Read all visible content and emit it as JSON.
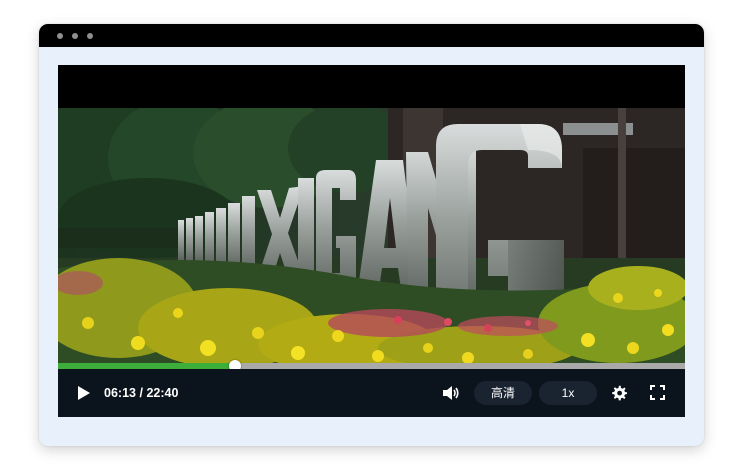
{
  "window": {
    "titlebar_dots": [
      "dot",
      "dot",
      "dot"
    ]
  },
  "player": {
    "video_description_icon": "video-frame",
    "progress": 0.2815,
    "controls": {
      "play_icon": "play-icon",
      "time_current": "06:13",
      "time_separator": "/",
      "time_total": "22:40",
      "volume_icon": "volume-icon",
      "quality_label": "高清",
      "speed_label": "1x",
      "settings_icon": "gear-icon",
      "fullscreen_icon": "fullscreen-icon"
    },
    "sculpture_letters": [
      "G",
      "N",
      "A",
      "G",
      "X",
      "N",
      "I",
      "X",
      "U",
      "M",
      "A",
      "G"
    ]
  },
  "colors": {
    "window_bg": "#e8f0fb",
    "titlebar": "#000000",
    "progress_fill": "#3dae3a",
    "progress_track": "#a9a9a9",
    "controls_bg": "#0b131c",
    "pill_bg": "#1a2430"
  }
}
